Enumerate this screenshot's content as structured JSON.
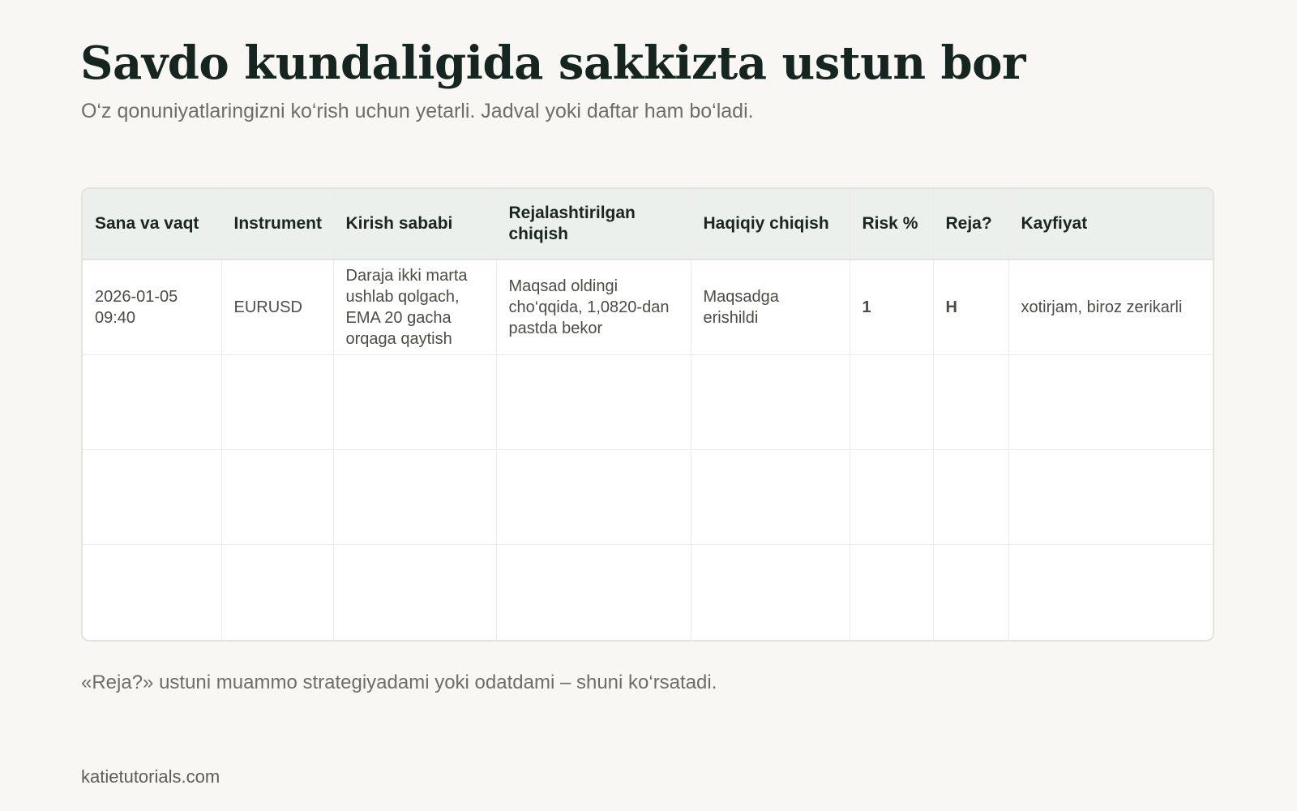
{
  "header": {
    "title": "Savdo kundaligida sakkizta ustun bor",
    "subtitle": "O‘z qonuniyatlaringizni ko‘rish uchun yetarli. Jadval yoki daftar ham bo‘ladi."
  },
  "table": {
    "columns": [
      "Sana va vaqt",
      "Instrument",
      "Kirish sababi",
      "Rejalashtirilgan chiqish",
      "Haqiqiy chiqish",
      "Risk %",
      "Reja?",
      "Kayfiyat"
    ],
    "rows": [
      {
        "date_time": "2026-01-05 09:40",
        "instrument": "EURUSD",
        "entry_reason": "Daraja ikki marta ushlab qolgach, EMA 20 gacha orqaga qaytish",
        "planned_exit": "Maqsad oldingi cho‘qqida, 1,0820-dan pastda bekor",
        "actual_exit": "Maqsadga erishildi",
        "risk": "1",
        "plan": "H",
        "mood": "xotirjam, biroz zerikarli"
      }
    ],
    "empty_rows": 3,
    "accent_color": "#1c8a68"
  },
  "note": "«Reja?» ustuni muammo strategiyadami yoki odatdami – shuni ko‘rsatadi.",
  "footer": "katietutorials.com"
}
